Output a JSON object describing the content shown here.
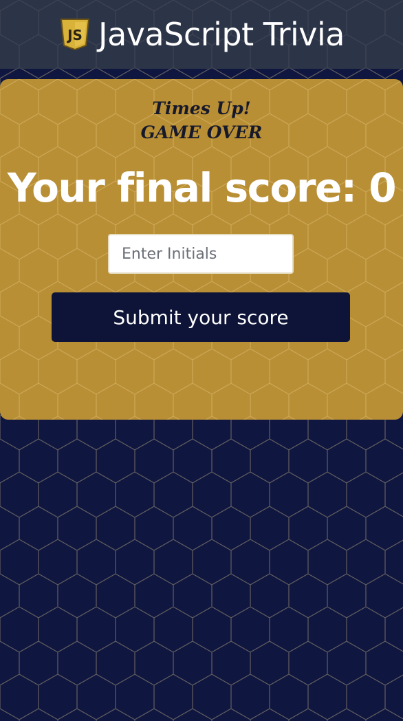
{
  "header": {
    "title": "JavaScript Trivia",
    "logo_icon": "javascript-shield-icon",
    "logo_text": "JS"
  },
  "game_over_card": {
    "times_up": "Times Up!",
    "game_over": "GAME OVER",
    "final_score_label": "Your final score: 0",
    "initials_placeholder": "Enter Initials",
    "initials_value": "",
    "submit_label": "Submit your score"
  },
  "colors": {
    "header_bg": "#2c3447",
    "card_bg": "#b98f36",
    "page_bg": "#0f1640",
    "button_bg": "#0e1437",
    "logo_gold": "#d9b23a"
  }
}
